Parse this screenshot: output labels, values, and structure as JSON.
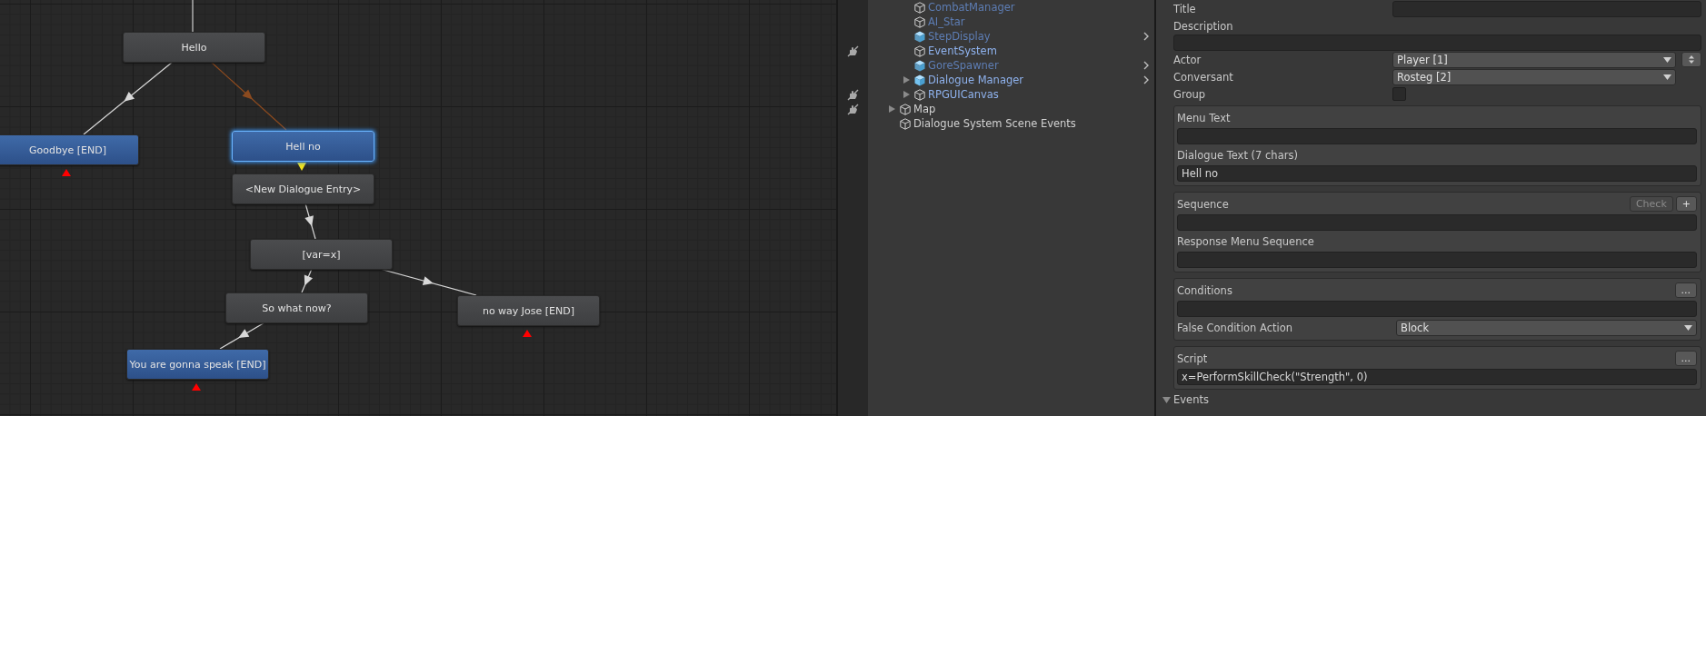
{
  "graph": {
    "nodes": [
      {
        "text": "Hello",
        "kind": "npc",
        "selected": false,
        "end_marker": false
      },
      {
        "text": "Goodbye [END]",
        "kind": "player",
        "selected": false,
        "end_marker": true
      },
      {
        "text": "Hell no",
        "kind": "player",
        "selected": true,
        "end_marker": false
      },
      {
        "text": "<New Dialogue Entry>",
        "kind": "npc",
        "selected": false,
        "end_marker": false
      },
      {
        "text": "[var=x]",
        "kind": "npc",
        "selected": false,
        "end_marker": false
      },
      {
        "text": "So what now?",
        "kind": "npc",
        "selected": false,
        "end_marker": false
      },
      {
        "text": "no way Jose [END]",
        "kind": "npc",
        "selected": false,
        "end_marker": true
      },
      {
        "text": "You are gonna speak [END]",
        "kind": "player",
        "selected": false,
        "end_marker": true
      }
    ]
  },
  "hierarchy": {
    "continued_children": [
      {
        "name": "CombatManager",
        "active": false,
        "prefab_icon": false,
        "expandable": false,
        "prefab_arrow": false,
        "pick_disabled": false
      },
      {
        "name": "AI_Star",
        "active": false,
        "prefab_icon": false,
        "expandable": false,
        "prefab_arrow": false,
        "pick_disabled": false
      },
      {
        "name": "StepDisplay",
        "active": false,
        "prefab_icon": true,
        "expandable": false,
        "prefab_arrow": true,
        "pick_disabled": false
      },
      {
        "name": "EventSystem",
        "active": true,
        "prefab_icon": false,
        "expandable": false,
        "prefab_arrow": false,
        "pick_disabled": true
      },
      {
        "name": "GoreSpawner",
        "active": false,
        "prefab_icon": true,
        "expandable": false,
        "prefab_arrow": true,
        "pick_disabled": false
      },
      {
        "name": "Dialogue Manager",
        "active": true,
        "prefab_icon": true,
        "expandable": true,
        "prefab_arrow": true,
        "pick_disabled": false
      },
      {
        "name": "RPGUICanvas",
        "active": true,
        "prefab_icon": false,
        "expandable": true,
        "prefab_arrow": false,
        "pick_disabled": true
      }
    ],
    "items": [
      {
        "name": "Map",
        "active": true,
        "prefab_icon": false,
        "expandable": true,
        "prefab_arrow": false,
        "pick_disabled": true,
        "plain": true
      },
      {
        "name": "Dialogue System Scene Events",
        "active": true,
        "prefab_icon": false,
        "expandable": false,
        "prefab_arrow": false,
        "pick_disabled": false,
        "plain": true
      }
    ]
  },
  "inspector": {
    "rows": [
      {
        "kind": "inline_field",
        "label": "Title"
      },
      {
        "kind": "text",
        "label": "Description"
      },
      {
        "kind": "dropdown",
        "label": "Actor",
        "value": "Player [1]",
        "spinner": true
      },
      {
        "kind": "dropdown",
        "label": "Conversant",
        "value": "Rosteg [2]",
        "spinner": false
      },
      {
        "kind": "checkbox",
        "label": "Group",
        "checked": false
      }
    ],
    "sections": [
      {
        "fields": [
          {
            "kind": "text",
            "label": "Menu Text"
          },
          {
            "kind": "text",
            "label": "Dialogue Text (7 chars)",
            "value": "Hell no"
          }
        ]
      },
      {
        "fields": [
          {
            "kind": "text",
            "label": "Sequence",
            "buttons": [
              {
                "text": "Check",
                "disabled": true
              },
              {
                "text": "+",
                "disabled": false
              }
            ]
          },
          {
            "kind": "text",
            "label": "Response Menu Sequence"
          }
        ]
      },
      {
        "fields": [
          {
            "kind": "text",
            "label": "Conditions",
            "buttons": [
              {
                "text": "...",
                "disabled": false
              }
            ]
          },
          {
            "kind": "dropdown",
            "label": "False Condition Action",
            "value": "Block"
          }
        ]
      },
      {
        "fields": [
          {
            "kind": "text",
            "label": "Script",
            "value": "x=PerformSkillCheck(\"Strength\", 0)",
            "buttons": [
              {
                "text": "...",
                "disabled": false
              }
            ]
          }
        ]
      }
    ],
    "events": {
      "label": "Events",
      "expanded": true
    }
  }
}
